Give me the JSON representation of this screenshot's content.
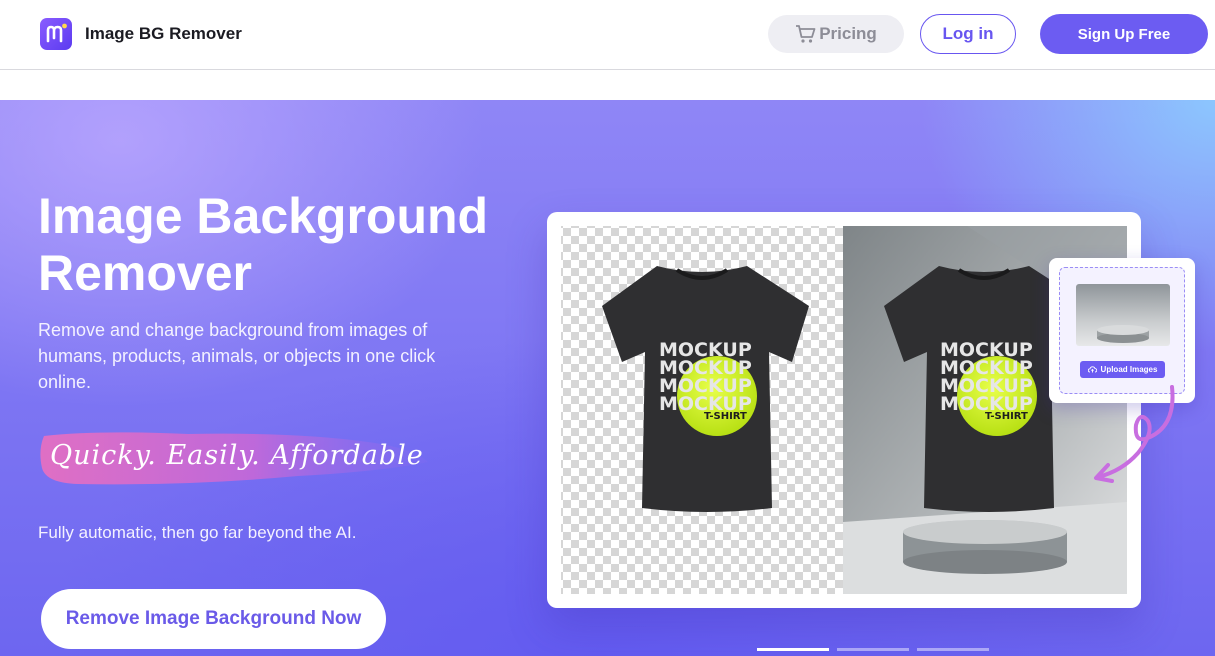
{
  "header": {
    "brand": "Image BG Remover",
    "logo_icon": "m-logo-icon",
    "pricing_label": "Pricing",
    "pricing_icon": "cart-icon",
    "login_label": "Log in",
    "signup_label": "Sign Up Free",
    "accent": "#6c5cf2"
  },
  "hero": {
    "title_line1": "Image Background",
    "title_line2": "Remover",
    "subtitle": "Remove and change background from images of humans, products, animals, or objects in one click online.",
    "tagline": "Quicky. Easily. Affordable",
    "note": "Fully automatic, then go far beyond the AI.",
    "cta_label": "Remove Image Background Now"
  },
  "demo": {
    "shirt_text": "MOCKUP",
    "shirt_subtext": "T-SHIRT",
    "upload_label": "Upload Images",
    "upload_icon": "cloud-upload-icon"
  },
  "carousel": {
    "slides": 3,
    "active_index": 0
  }
}
